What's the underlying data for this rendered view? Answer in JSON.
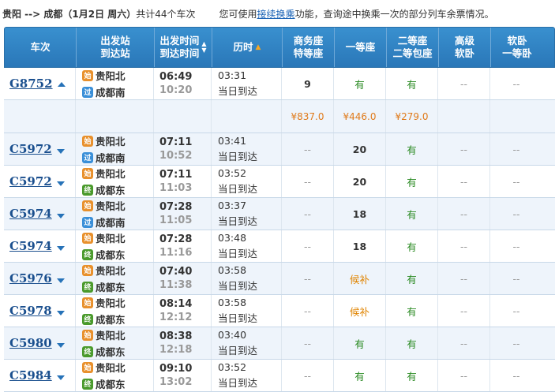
{
  "topbar": {
    "route": "贵阳 --> 成都（1月2日  周六）",
    "count": "共计44个车次",
    "tip_prefix": "您可使用",
    "tip_link": "接续换乘",
    "tip_suffix": "功能，查询途中换乘一次的部分列车余票情况。"
  },
  "header": {
    "train": "车次",
    "station_top": "出发站",
    "station_bottom": "到达站",
    "time_top": "出发时间",
    "time_bottom": "到达时间",
    "duration": "历时",
    "seat1_top": "商务座",
    "seat1_bottom": "特等座",
    "seat2": "一等座",
    "seat3_top": "二等座",
    "seat3_bottom": "二等包座",
    "seat4_top": "高级",
    "seat4_bottom": "软卧",
    "seat5_top": "软卧",
    "seat5_bottom": "一等卧"
  },
  "badges": {
    "start": "始",
    "pass": "过",
    "end": "终"
  },
  "rows": [
    {
      "train": "G8752",
      "expanded": true,
      "from": "贵阳北",
      "from_badge": "始",
      "to": "成都南",
      "to_badge": "过",
      "dep": "06:49",
      "arr": "10:20",
      "dur": "03:31",
      "note": "当日到达",
      "s1": "9",
      "s2": "有",
      "s3": "有",
      "s4": "--",
      "s5": "--"
    },
    {
      "train": "C5972",
      "expanded": false,
      "from": "贵阳北",
      "from_badge": "始",
      "to": "成都南",
      "to_badge": "过",
      "dep": "07:11",
      "arr": "10:52",
      "dur": "03:41",
      "note": "当日到达",
      "s1": "--",
      "s2": "20",
      "s3": "有",
      "s4": "--",
      "s5": "--"
    },
    {
      "train": "C5972",
      "expanded": false,
      "from": "贵阳北",
      "from_badge": "始",
      "to": "成都东",
      "to_badge": "终",
      "dep": "07:11",
      "arr": "11:03",
      "dur": "03:52",
      "note": "当日到达",
      "s1": "--",
      "s2": "20",
      "s3": "有",
      "s4": "--",
      "s5": "--"
    },
    {
      "train": "C5974",
      "expanded": false,
      "from": "贵阳北",
      "from_badge": "始",
      "to": "成都南",
      "to_badge": "过",
      "dep": "07:28",
      "arr": "11:05",
      "dur": "03:37",
      "note": "当日到达",
      "s1": "--",
      "s2": "18",
      "s3": "有",
      "s4": "--",
      "s5": "--"
    },
    {
      "train": "C5974",
      "expanded": false,
      "from": "贵阳北",
      "from_badge": "始",
      "to": "成都东",
      "to_badge": "终",
      "dep": "07:28",
      "arr": "11:16",
      "dur": "03:48",
      "note": "当日到达",
      "s1": "--",
      "s2": "18",
      "s3": "有",
      "s4": "--",
      "s5": "--"
    },
    {
      "train": "C5976",
      "expanded": false,
      "from": "贵阳北",
      "from_badge": "始",
      "to": "成都东",
      "to_badge": "终",
      "dep": "07:40",
      "arr": "11:38",
      "dur": "03:58",
      "note": "当日到达",
      "s1": "--",
      "s2": "候补",
      "s3": "有",
      "s4": "--",
      "s5": "--"
    },
    {
      "train": "C5978",
      "expanded": false,
      "from": "贵阳北",
      "from_badge": "始",
      "to": "成都东",
      "to_badge": "终",
      "dep": "08:14",
      "arr": "12:12",
      "dur": "03:58",
      "note": "当日到达",
      "s1": "--",
      "s2": "候补",
      "s3": "有",
      "s4": "--",
      "s5": "--"
    },
    {
      "train": "C5980",
      "expanded": false,
      "from": "贵阳北",
      "from_badge": "始",
      "to": "成都东",
      "to_badge": "终",
      "dep": "08:38",
      "arr": "12:18",
      "dur": "03:40",
      "note": "当日到达",
      "s1": "--",
      "s2": "有",
      "s3": "有",
      "s4": "--",
      "s5": "--"
    },
    {
      "train": "C5984",
      "expanded": false,
      "from": "贵阳北",
      "from_badge": "始",
      "to": "成都东",
      "to_badge": "终",
      "dep": "09:10",
      "arr": "13:02",
      "dur": "03:52",
      "note": "当日到达",
      "s1": "--",
      "s2": "有",
      "s3": "有",
      "s4": "--",
      "s5": "--"
    }
  ],
  "price_row": {
    "s1": "¥837.0",
    "s2": "¥446.0",
    "s3": "¥279.0"
  },
  "colors": {
    "header_bg": "#2f82c4",
    "train_link": "#1a4f8e",
    "available": "#2a8a22",
    "waitlist": "#e08400",
    "price": "#e07a1a"
  }
}
